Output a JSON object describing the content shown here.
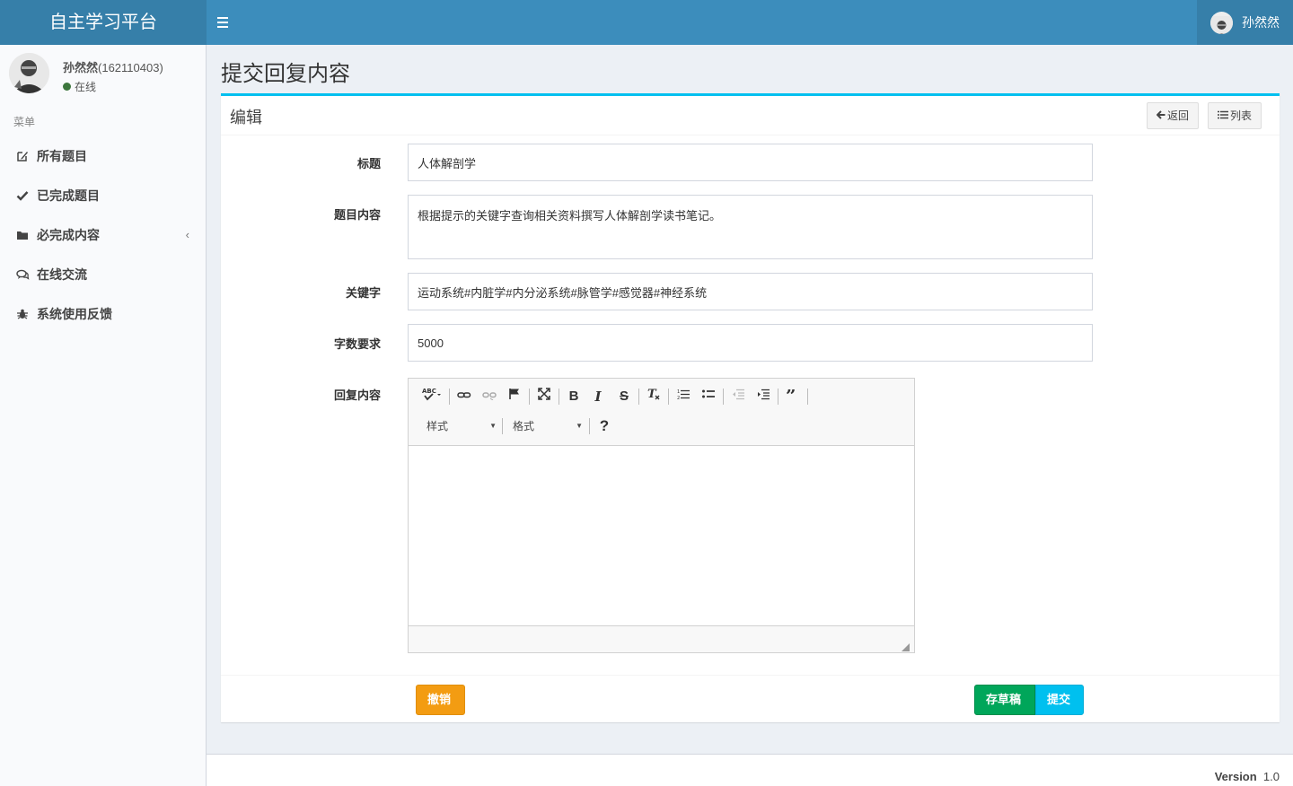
{
  "app": {
    "logo": "自主学习平台",
    "user_name": "孙然然"
  },
  "sidebar": {
    "user": {
      "name": "孙然然",
      "id": "(162110403)",
      "status": "在线"
    },
    "menu_header": "菜单",
    "items": [
      {
        "label": "所有题目",
        "icon": "edit-icon"
      },
      {
        "label": "已完成题目",
        "icon": "check-icon"
      },
      {
        "label": "必完成内容",
        "icon": "folder-icon",
        "caret": "‹"
      },
      {
        "label": "在线交流",
        "icon": "comments-icon"
      },
      {
        "label": "系统使用反馈",
        "icon": "bug-icon"
      }
    ]
  },
  "page": {
    "title": "提交回复内容"
  },
  "box": {
    "title": "编辑",
    "back_label": "返回",
    "list_label": "列表"
  },
  "form": {
    "title_label": "标题",
    "title_value": "人体解剖学",
    "content_label": "题目内容",
    "content_value": "根据提示的关键字查询相关资料撰写人体解剖学读书笔记。",
    "keywords_label": "关键字",
    "keywords_value": "运动系统#内脏学#内分泌系统#脉管学#感觉器#神经系统",
    "wordcount_label": "字数要求",
    "wordcount_value": "5000",
    "reply_label": "回复内容"
  },
  "editor": {
    "style_combo": "样式",
    "format_combo": "格式",
    "help": "?"
  },
  "buttons": {
    "cancel": "撤销",
    "draft": "存草稿",
    "submit": "提交"
  },
  "colors": {
    "header": "#3c8dbc",
    "box_accent": "#00c0ef",
    "cancel": "#f39c12",
    "draft": "#00a65a",
    "submit": "#00c0ef"
  },
  "footer": {
    "version_label": "Version",
    "version_value": "1.0"
  }
}
